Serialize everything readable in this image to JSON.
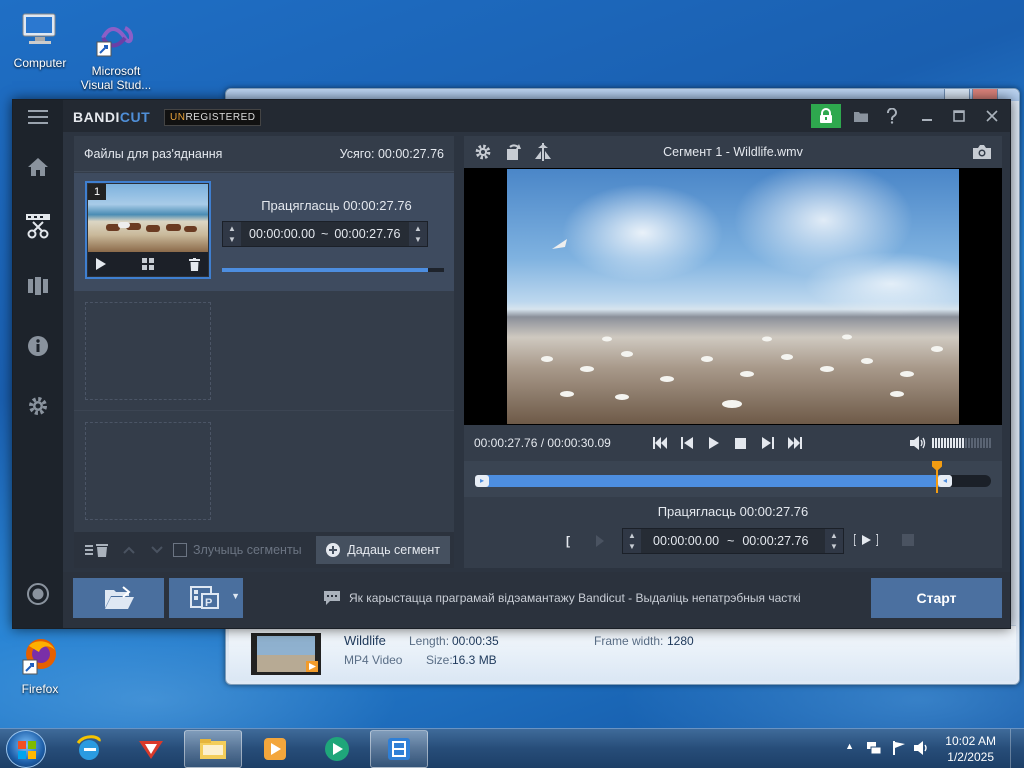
{
  "desktop": {
    "icons": [
      {
        "label": "Computer"
      },
      {
        "label": "Microsoft Visual Stud..."
      },
      {
        "label": "Firefox"
      }
    ]
  },
  "bg_window": {
    "file_name": "Wildlife",
    "file_type": "MP4 Video",
    "length_label": "Length:",
    "length_value": "00:00:35",
    "size_label": "Size:",
    "size_value": "16.3 MB",
    "frame_width_label": "Frame width:",
    "frame_width_value": "1280"
  },
  "app": {
    "brand_a": "BANDI",
    "brand_b": "CUT",
    "unreg_a": "UN",
    "unreg_b": "REGISTERED",
    "left_panel": {
      "title": "Файлы для раз'яднання",
      "total": "Усяго: 00:00:27.76",
      "segment_number": "1",
      "duration": "Працягласць 00:00:27.76",
      "start_time": "00:00:00.00",
      "sep": "~",
      "end_time": "00:00:27.76",
      "progress": 0.93,
      "merge_label": "Злучыць сегменты",
      "add_segment": "Дадаць сегмент"
    },
    "right_panel": {
      "title": "Сегмент 1 - Wildlife.wmv",
      "position": "00:00:27.76 / 00:00:30.09",
      "duration": "Працягласць 00:00:27.76",
      "start_time": "00:00:00.00",
      "sep": "~",
      "end_time": "00:00:27.76",
      "volume": 0.55,
      "selection": 0.92
    },
    "bottom": {
      "tip": "Як карыстацца праграмай відэамантажу Bandicut - Выдаліць непатрэбныя часткі",
      "start": "Старт"
    }
  },
  "taskbar": {
    "time": "10:02 AM",
    "date": "1/2/2025"
  },
  "colors": {
    "accent": "#4d8ee0",
    "playhead": "#f39c12",
    "lock": "#2ea84e",
    "start_button": "#4b70a0"
  }
}
